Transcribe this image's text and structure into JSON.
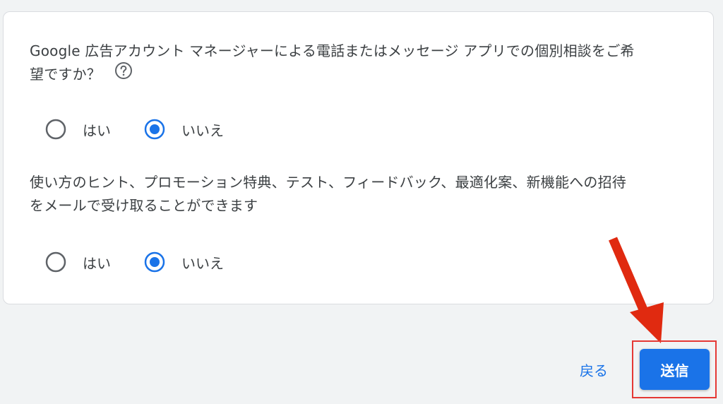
{
  "questions": [
    {
      "text_line1": "Google 広告アカウント マネージャーによる電話またはメッセージ アプリでの個別相談をご希",
      "text_line2": "望ですか？",
      "has_help_icon": true,
      "options": [
        "はい",
        "いいえ"
      ],
      "selected": "いいえ"
    },
    {
      "text_line1": "使い方のヒント、プロモーション特典、テスト、フィードバック、最適化案、新機能への招待",
      "text_line2": "をメールで受け取ることができます",
      "has_help_icon": false,
      "options": [
        "はい",
        "いいえ"
      ],
      "selected": "いいえ"
    }
  ],
  "footer": {
    "back_label": "戻る",
    "submit_label": "送信"
  },
  "icons": {
    "help": "help-circle-icon",
    "radio_unchecked": "radio-unchecked-icon",
    "radio_checked": "radio-checked-icon",
    "annotation_arrow": "red-arrow-icon"
  },
  "colors": {
    "primary": "#1a73e8",
    "text": "#3c4043",
    "radio_unchecked": "#5f6368",
    "annotation": "#e53935",
    "background": "#f1f3f4"
  }
}
